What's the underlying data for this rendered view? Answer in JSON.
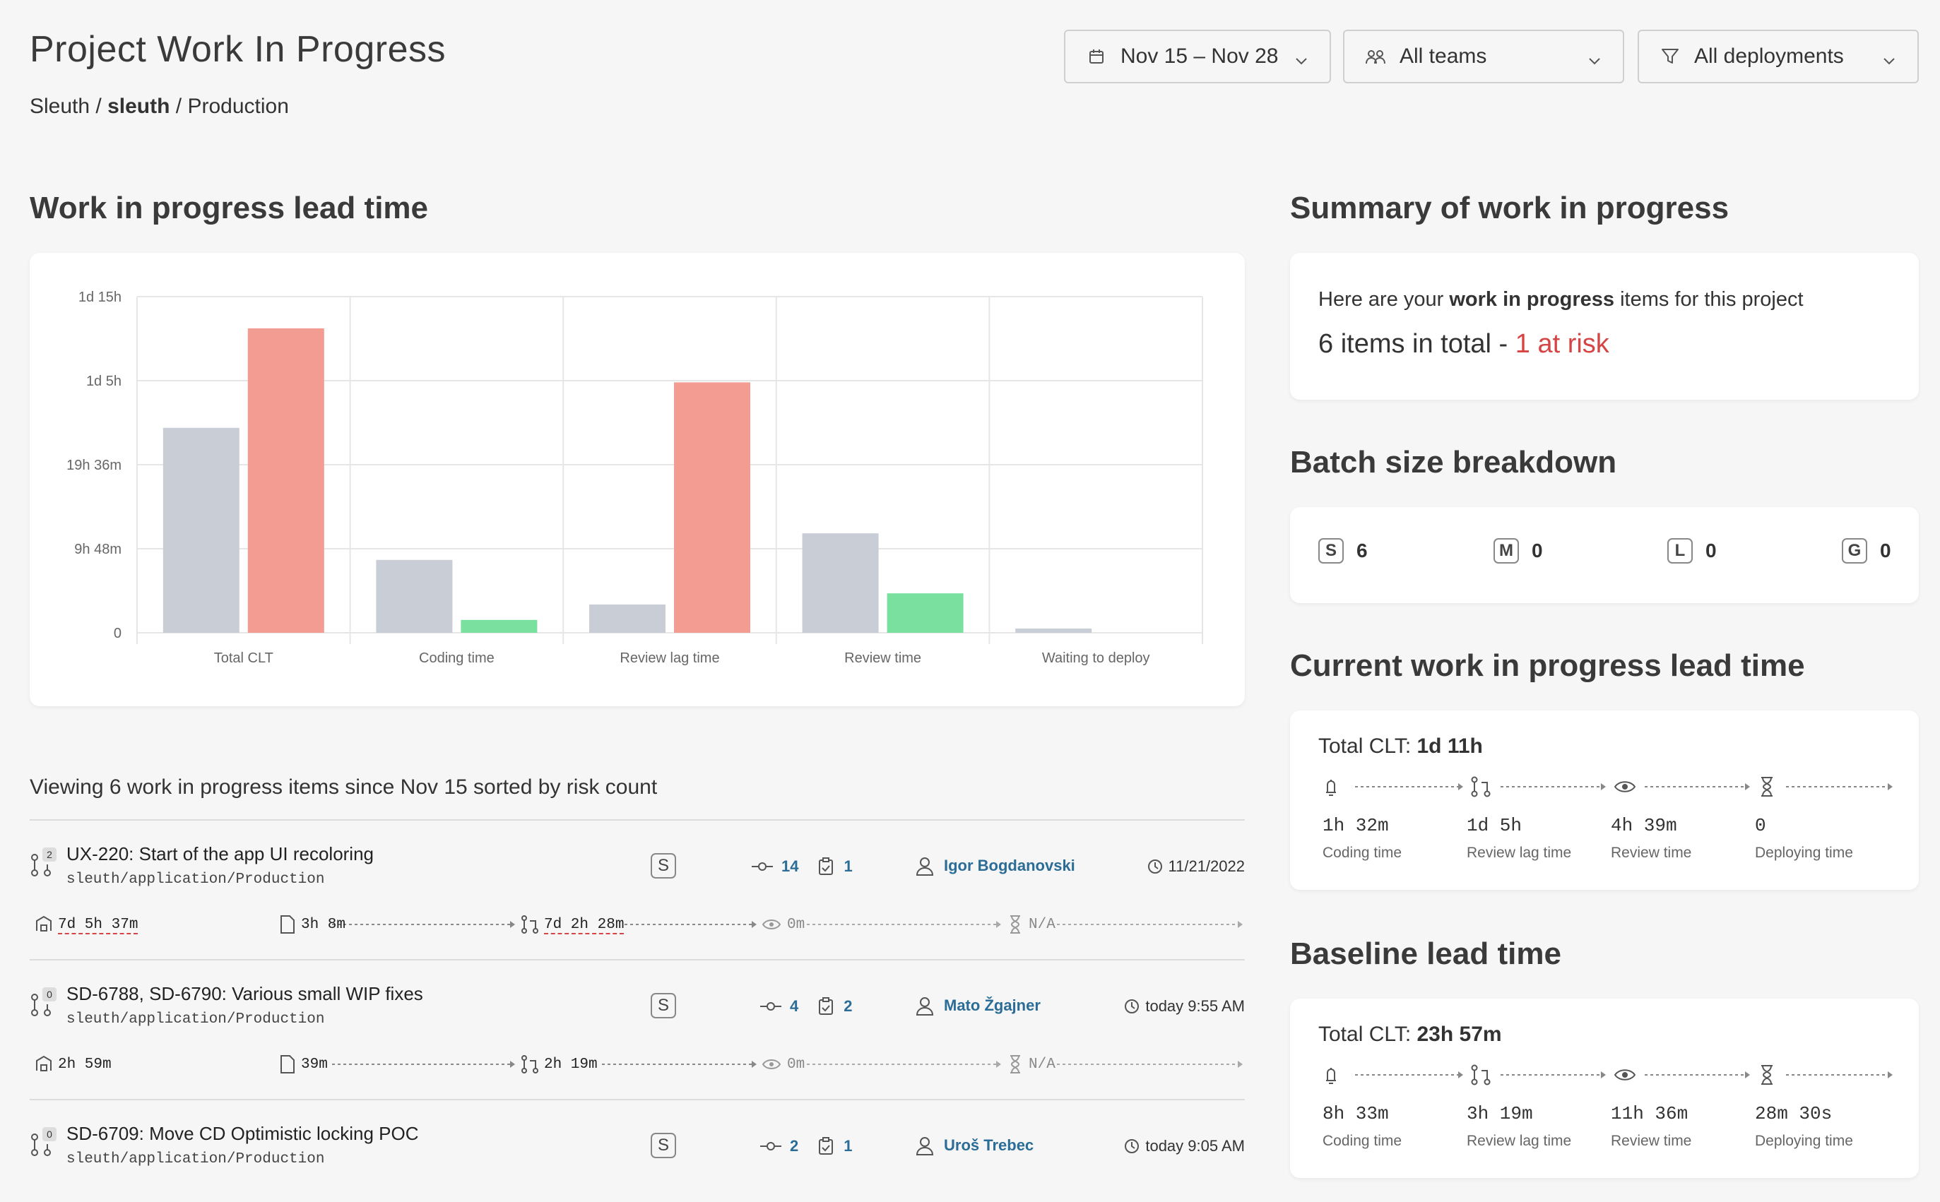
{
  "header": {
    "title": "Project Work In Progress",
    "crumb_org": "Sleuth",
    "crumb_project": "sleuth",
    "crumb_env": "Production",
    "date_range": "Nov 15 – Nov 28",
    "teams": "All teams",
    "deployments": "All deployments"
  },
  "wip_chart": {
    "heading": "Work in progress lead time"
  },
  "chart_data": {
    "type": "bar",
    "categories": [
      "Total CLT",
      "Coding time",
      "Review lag time",
      "Review time",
      "Waiting to deploy"
    ],
    "ytick_labels": [
      "0",
      "9h 48m",
      "19h 36m",
      "1d 5h",
      "1d 15h"
    ],
    "ytick_values_hours": [
      0,
      9.8,
      19.6,
      29.4,
      39.2
    ],
    "ylim_hours": [
      0,
      39.2
    ],
    "series": [
      {
        "values_hours": [
          23.9,
          8.5,
          3.3,
          11.6,
          0.5
        ],
        "color": "#c9cdd6"
      },
      {
        "values_hours": [
          35.5,
          1.5,
          29.2,
          4.6,
          0
        ],
        "colors": [
          "#f29c92",
          "#79e0a0",
          "#f29c92",
          "#79e0a0",
          "#79e0a0"
        ]
      }
    ]
  },
  "summary": {
    "heading": "Summary of work in progress",
    "intro_pre": "Here are your ",
    "intro_bold": "work in progress",
    "intro_post": " items for this project",
    "count_text": "6 items in total - ",
    "risk_text": "1 at risk"
  },
  "batch": {
    "heading": "Batch size breakdown",
    "items": [
      {
        "badge": "S",
        "count": "6"
      },
      {
        "badge": "M",
        "count": "0"
      },
      {
        "badge": "L",
        "count": "0"
      },
      {
        "badge": "G",
        "count": "0"
      }
    ]
  },
  "current_lt": {
    "heading": "Current work in progress lead time",
    "clt_label": "Total CLT: ",
    "clt_value": "1d 11h",
    "stages": [
      {
        "value": "1h 32m",
        "label": "Coding time"
      },
      {
        "value": "1d 5h",
        "label": "Review lag time"
      },
      {
        "value": "4h 39m",
        "label": "Review time"
      },
      {
        "value": "0",
        "label": "Deploying time"
      }
    ]
  },
  "baseline_lt": {
    "heading": "Baseline lead time",
    "clt_label": "Total CLT: ",
    "clt_value": "23h 57m",
    "stages": [
      {
        "value": "8h 33m",
        "label": "Coding time"
      },
      {
        "value": "3h 19m",
        "label": "Review lag time"
      },
      {
        "value": "11h 36m",
        "label": "Review time"
      },
      {
        "value": "28m 30s",
        "label": "Deploying time"
      }
    ]
  },
  "list": {
    "viewing_text": "Viewing 6 work in progress items since Nov 15 sorted by risk count",
    "items": [
      {
        "pr_count": "2",
        "title": "UX-220: Start of the app UI recoloring",
        "path": "sleuth/application/Production",
        "batch": "S",
        "commits": "14",
        "issues": "1",
        "author": "Igor Bogdanovski",
        "date": "11/21/2022",
        "total": "7d 5h 37m",
        "coding": "3h 8m",
        "review_lag": "7d 2h 28m",
        "review": "0m",
        "deploy": "N/A"
      },
      {
        "pr_count": "0",
        "title": "SD-6788, SD-6790: Various small WIP fixes",
        "path": "sleuth/application/Production",
        "batch": "S",
        "commits": "4",
        "issues": "2",
        "author": "Mato Žgajner",
        "date": "today 9:55 AM",
        "total": "2h 59m",
        "coding": "39m",
        "review_lag": "2h 19m",
        "review": "0m",
        "deploy": "N/A"
      },
      {
        "pr_count": "0",
        "title": "SD-6709: Move CD Optimistic locking POC",
        "path": "sleuth/application/Production",
        "batch": "S",
        "commits": "2",
        "issues": "1",
        "author": "Uroš Trebec",
        "date": "today 9:05 AM"
      }
    ]
  }
}
